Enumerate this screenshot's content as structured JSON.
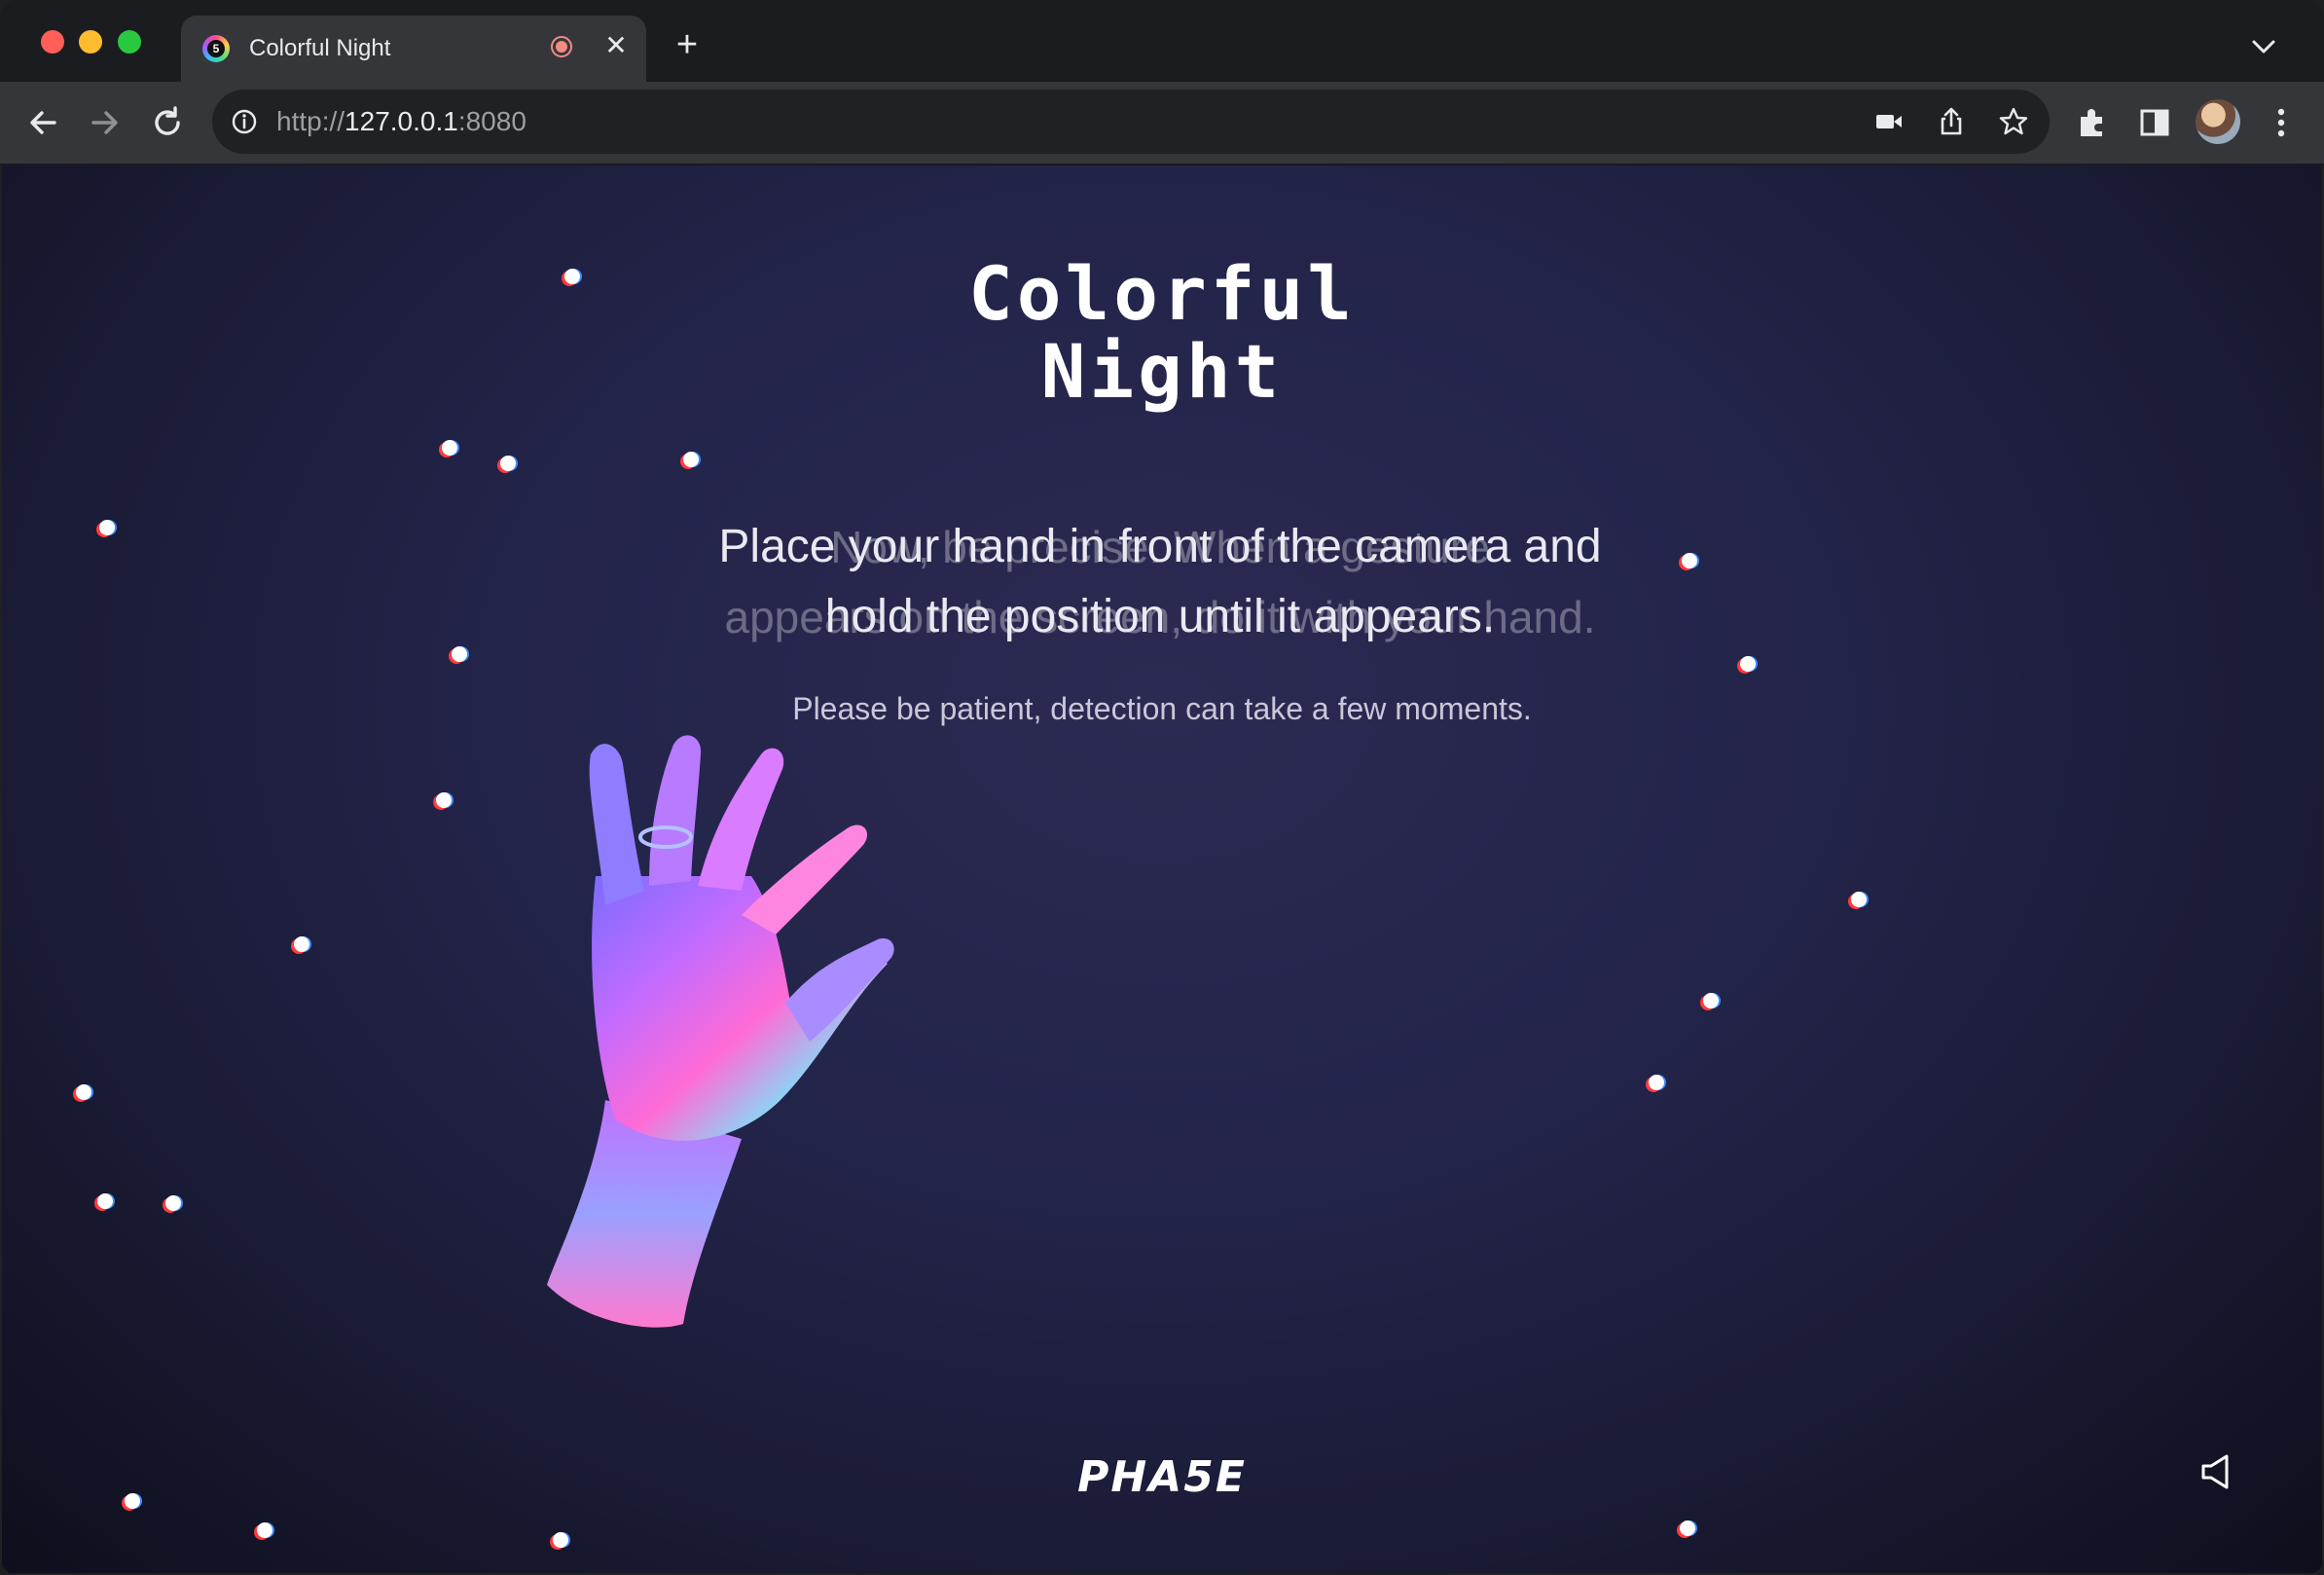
{
  "browser": {
    "tab": {
      "title": "Colorful Night",
      "favicon_letter": "5"
    },
    "address": {
      "scheme": "http://",
      "host": "127.0.0.1",
      "port": ":8080"
    }
  },
  "page": {
    "title_line1": "Colorful",
    "title_line2": "Night",
    "instruction_line1": "Place your hand in front of the camera and",
    "instruction_line2": "hold the position until it appears.",
    "ghost_line1": "Now, be precise. When a gesture",
    "ghost_line2": "appears on the screen, do it with your hand.",
    "patience": "Please be patient, detection can take a few moments.",
    "logo": "PHA5E"
  },
  "colors": {
    "background": "#23244a",
    "tab_active": "#35363a",
    "toolbar": "#35363a",
    "recording_dot": "#f28b82"
  },
  "icons": [
    "back-arrow-icon",
    "forward-arrow-icon",
    "reload-icon",
    "info-icon",
    "camera-icon",
    "share-icon",
    "star-icon",
    "extensions-icon",
    "side-panel-icon",
    "menu-icon",
    "sound-icon"
  ]
}
